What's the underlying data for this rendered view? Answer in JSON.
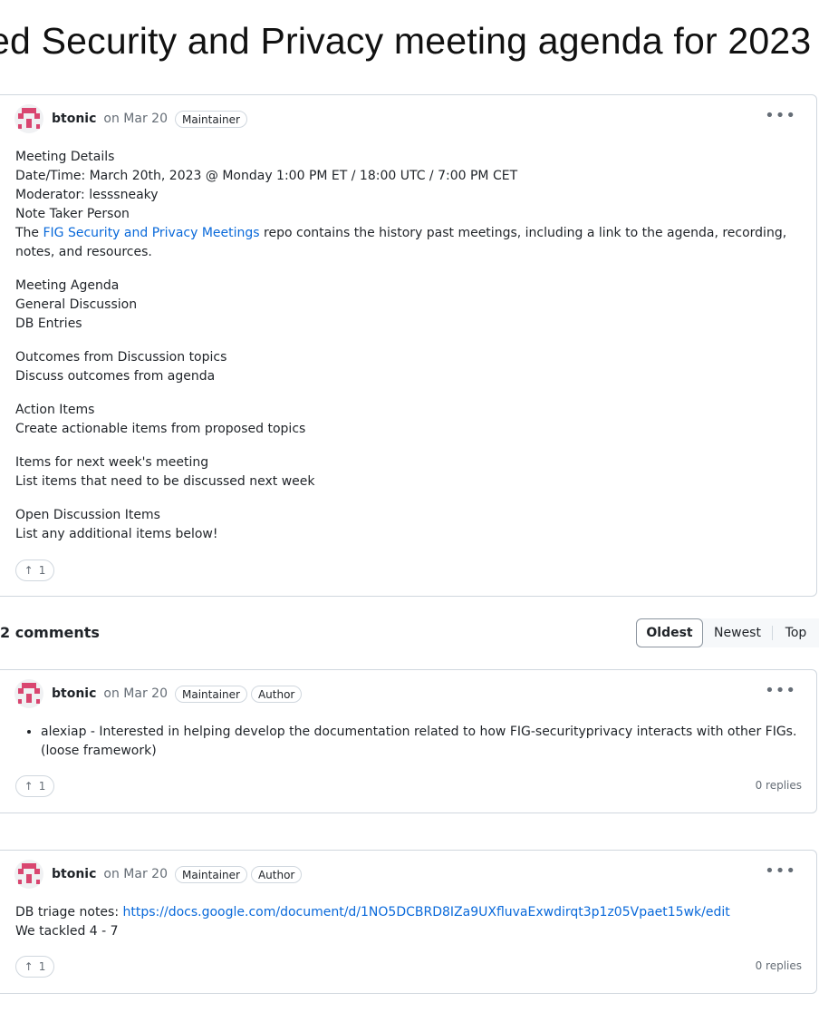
{
  "page": {
    "title": "ed Security and Privacy meeting agenda for 2023"
  },
  "post": {
    "author": "btonic",
    "date": "on Mar 20",
    "badges": [
      "Maintainer"
    ],
    "lines_details": [
      "Meeting Details",
      "Date/Time: March 20th, 2023 @ Monday 1:00 PM ET / 18:00 UTC / 7:00 PM CET",
      "Moderator: lesssneaky",
      "Note Taker Person"
    ],
    "repo_prefix": "The ",
    "repo_link": "FIG Security and Privacy Meetings",
    "repo_suffix": " repo contains the history past meetings, including a link to the agenda, recording, notes, and resources.",
    "sections": [
      [
        "Meeting Agenda",
        "General Discussion",
        "DB Entries"
      ],
      [
        "Outcomes from Discussion topics",
        "Discuss outcomes from agenda"
      ],
      [
        "Action Items",
        "Create actionable items from proposed topics"
      ],
      [
        "Items for next week's meeting",
        "List items that need to be discussed next week"
      ],
      [
        "Open Discussion Items",
        "List any additional items below!"
      ]
    ],
    "upvotes": "1"
  },
  "comments_header": {
    "title": "2 comments",
    "sort": [
      "Oldest",
      "Newest",
      "Top"
    ],
    "active_sort": "Oldest"
  },
  "comments": [
    {
      "author": "btonic",
      "date": "on Mar 20",
      "badges": [
        "Maintainer",
        "Author"
      ],
      "bullet": "alexiap - Interested in helping develop the documentation related to how FIG-securityprivacy interacts with other FIGs. (loose framework)",
      "upvotes": "1",
      "replies": "0 replies"
    },
    {
      "author": "btonic",
      "date": "on Mar 20",
      "badges": [
        "Maintainer",
        "Author"
      ],
      "notes_prefix": "DB triage notes: ",
      "notes_link": "https://docs.google.com/document/d/1NO5DCBRD8IZa9UXfluvaExwdirqt3p1z05Vpaet15wk/edit",
      "line2": "We tackled 4 - 7",
      "upvotes": "1",
      "replies": "0 replies"
    }
  ],
  "colors": {
    "link": "#0969da",
    "avatar_accent": "#d94670",
    "border": "#d0d7de"
  },
  "icons": [
    "avatar-identicon",
    "kebab-icon",
    "arrow-up-icon"
  ]
}
